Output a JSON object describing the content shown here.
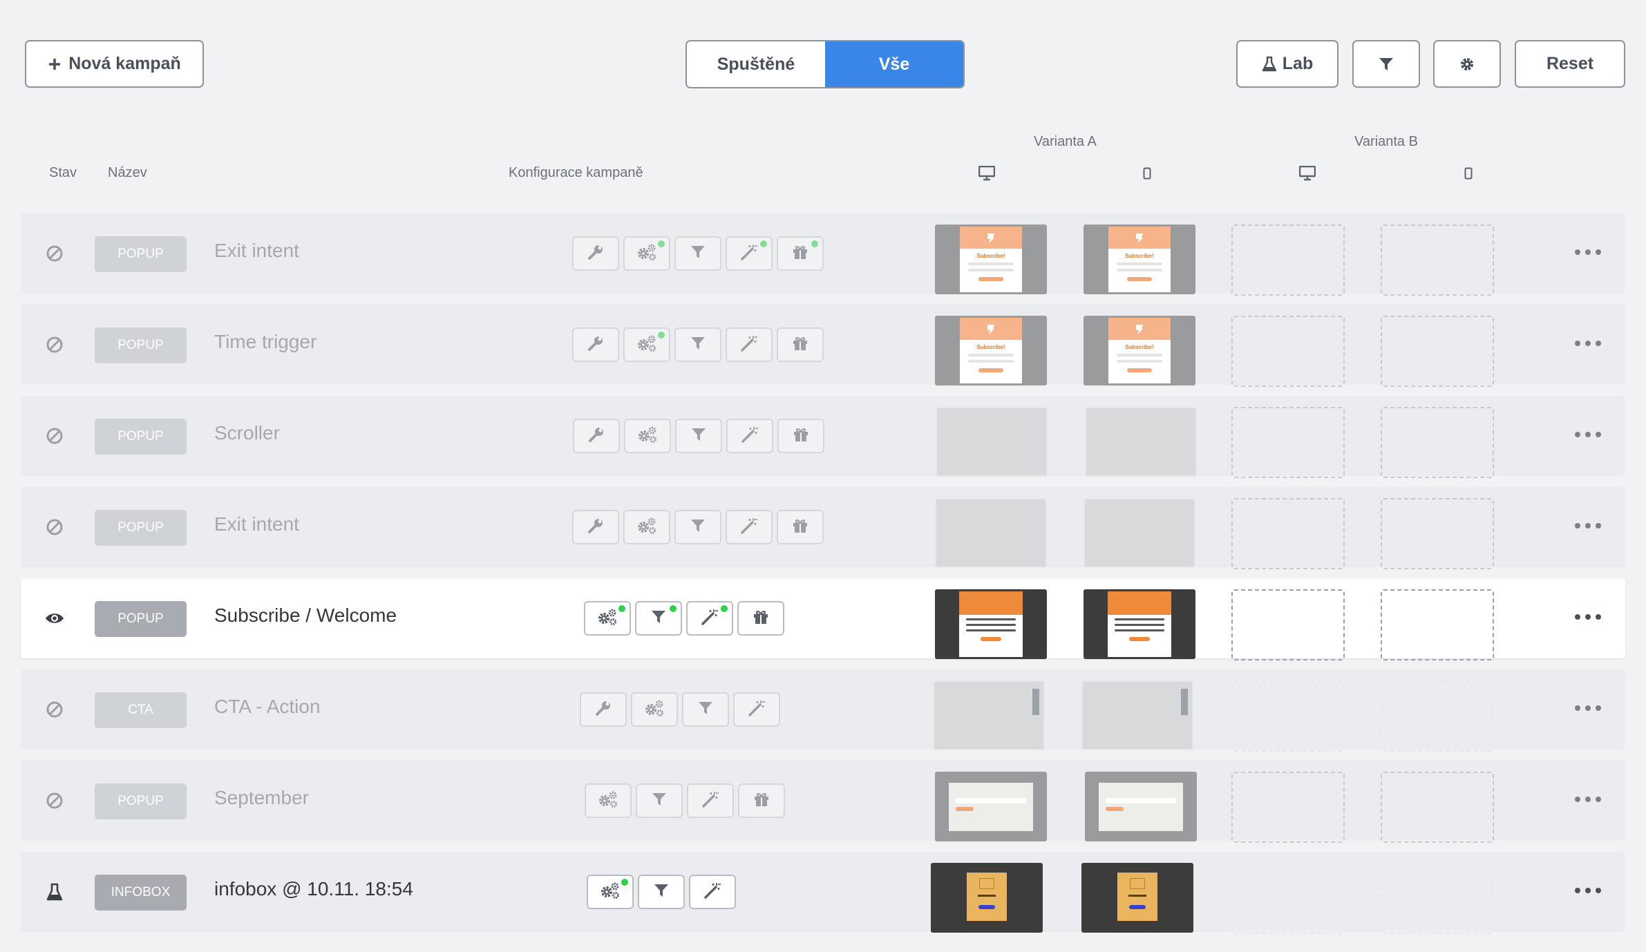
{
  "toolbar": {
    "new_campaign_label": "Nová kampaň",
    "lab_label": "Lab",
    "reset_label": "Reset",
    "filter_options": [
      "Spuštěné",
      "Vše"
    ],
    "selected_filter": "Vše"
  },
  "headers": {
    "status": "Stav",
    "name": "Název",
    "config": "Konfigurace kampaně",
    "variant_a": "Varianta A",
    "variant_b": "Varianta B"
  },
  "colors": {
    "accent": "#3a86e8",
    "active_dot": "#2fd04a"
  },
  "campaigns": [
    {
      "status": "disabled-icon",
      "type": "POPUP",
      "name": "Exit intent",
      "tools": [
        "wrench-icon",
        "gears-icon",
        "filter-icon",
        "wand-icon",
        "gift-icon"
      ],
      "tool_dots": [
        false,
        true,
        false,
        true,
        true
      ],
      "variant_a": [
        "subscribe-preview",
        "subscribe-preview"
      ],
      "variant_b": [
        "empty",
        "empty"
      ]
    },
    {
      "status": "disabled-icon",
      "type": "POPUP",
      "name": "Time trigger",
      "tools": [
        "wrench-icon",
        "gears-icon",
        "filter-icon",
        "wand-icon",
        "gift-icon"
      ],
      "tool_dots": [
        false,
        true,
        false,
        false,
        false
      ],
      "variant_a": [
        "subscribe-preview",
        "subscribe-preview"
      ],
      "variant_b": [
        "empty",
        "empty"
      ]
    },
    {
      "status": "disabled-icon",
      "type": "POPUP",
      "name": "Scroller",
      "tools": [
        "wrench-icon",
        "gears-icon",
        "filter-icon",
        "wand-icon",
        "gift-icon"
      ],
      "tool_dots": [
        false,
        false,
        false,
        false,
        false
      ],
      "variant_a": [
        "blank",
        "blank"
      ],
      "variant_b": [
        "empty",
        "empty"
      ]
    },
    {
      "status": "disabled-icon",
      "type": "POPUP",
      "name": "Exit intent",
      "tools": [
        "wrench-icon",
        "gears-icon",
        "filter-icon",
        "wand-icon",
        "gift-icon"
      ],
      "tool_dots": [
        false,
        false,
        false,
        false,
        false
      ],
      "variant_a": [
        "blank",
        "blank"
      ],
      "variant_b": [
        "empty",
        "empty"
      ]
    },
    {
      "status": "visible-icon",
      "type": "POPUP",
      "name": "Subscribe / Welcome",
      "tools": [
        "gears-icon",
        "filter-icon",
        "wand-icon",
        "gift-icon"
      ],
      "tool_dots": [
        true,
        true,
        true,
        false
      ],
      "variant_a": [
        "welcome-preview",
        "welcome-preview"
      ],
      "variant_b": [
        "empty",
        "empty"
      ]
    },
    {
      "status": "disabled-icon",
      "type": "CTA",
      "name": "CTA - Action",
      "tools": [
        "wrench-icon",
        "gears-icon",
        "filter-icon",
        "wand-icon"
      ],
      "tool_dots": [
        false,
        false,
        false,
        false
      ],
      "variant_a": [
        "cta-preview",
        "cta-preview"
      ],
      "variant_b": [
        "none",
        "none"
      ]
    },
    {
      "status": "disabled-icon",
      "type": "POPUP",
      "name": "September",
      "tools": [
        "gears-icon",
        "filter-icon",
        "wand-icon",
        "gift-icon"
      ],
      "tool_dots": [
        false,
        false,
        false,
        false
      ],
      "variant_a": [
        "september-preview",
        "september-preview"
      ],
      "variant_b": [
        "empty",
        "empty"
      ]
    },
    {
      "status": "lab-icon",
      "type": "INFOBOX",
      "name": "infobox @ 10.11. 18:54",
      "tools": [
        "gears-icon",
        "filter-icon",
        "wand-icon"
      ],
      "tool_dots": [
        true,
        false,
        false
      ],
      "variant_a": [
        "infobox-preview",
        "infobox-preview"
      ],
      "variant_b": [
        "none",
        "none"
      ]
    }
  ]
}
